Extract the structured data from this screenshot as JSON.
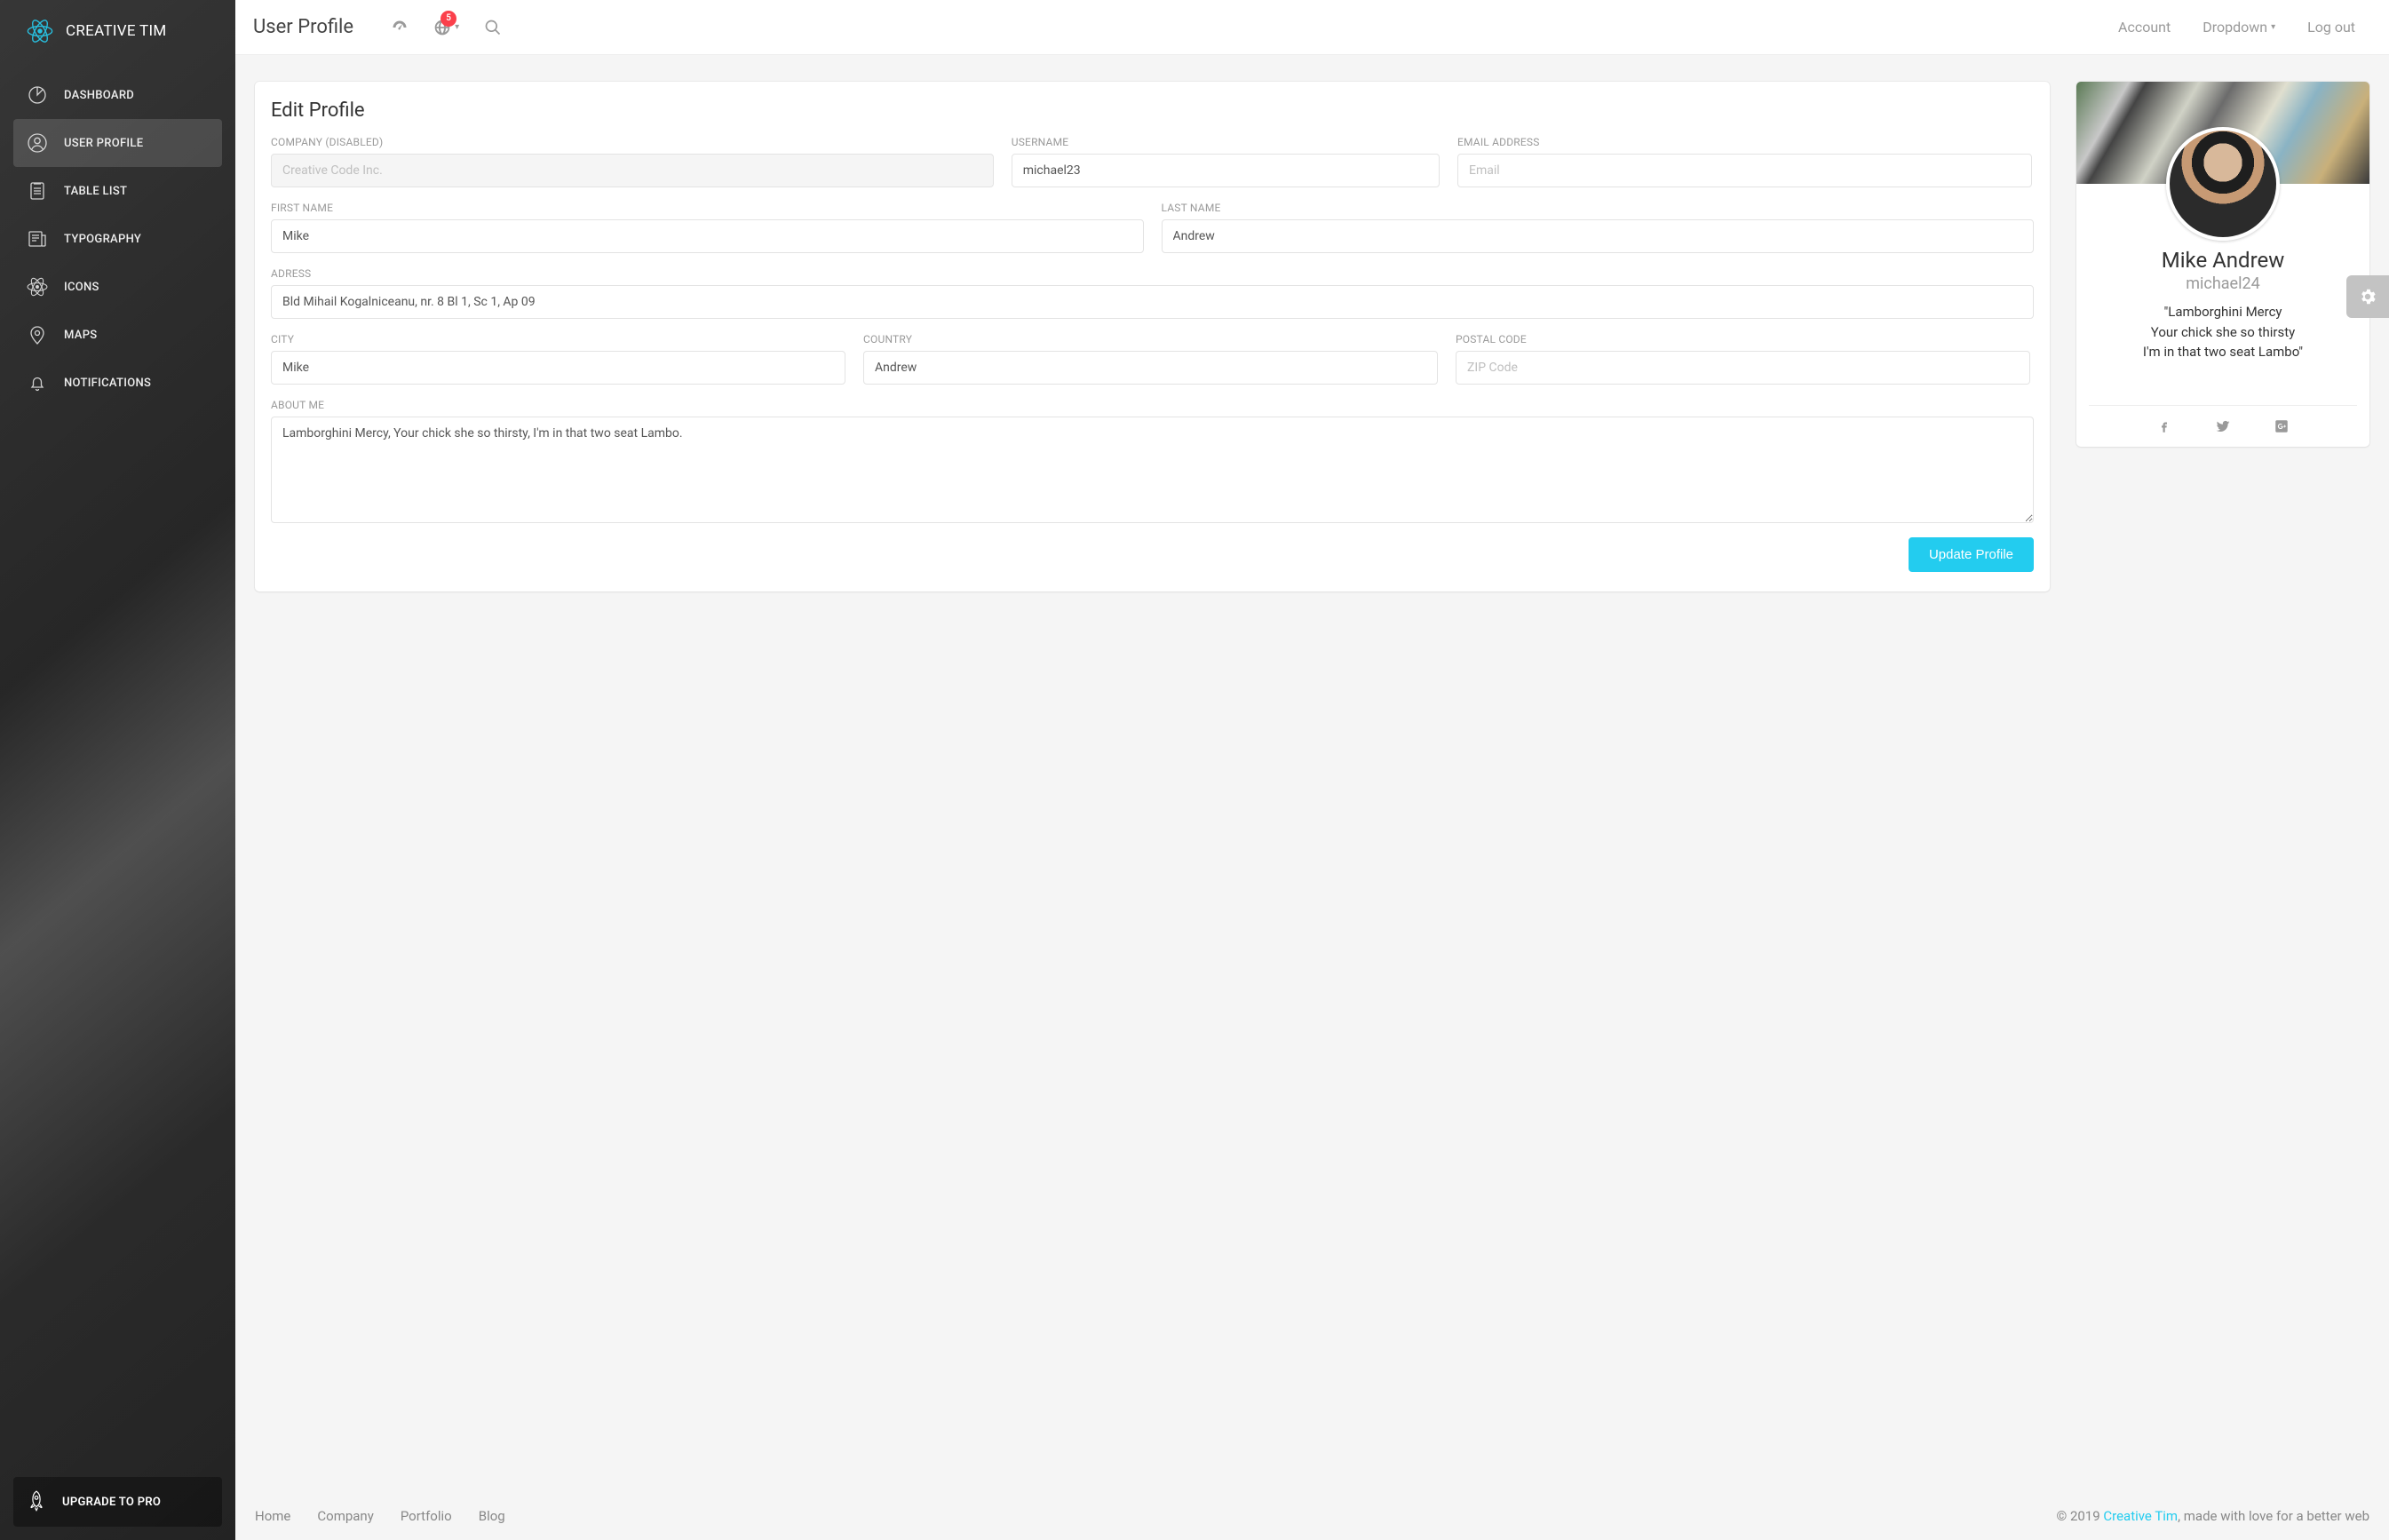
{
  "brand": "CREATIVE TIM",
  "sidebar": {
    "items": [
      {
        "label": "DASHBOARD"
      },
      {
        "label": "USER PROFILE",
        "active": true
      },
      {
        "label": "TABLE LIST"
      },
      {
        "label": "TYPOGRAPHY"
      },
      {
        "label": "ICONS"
      },
      {
        "label": "MAPS"
      },
      {
        "label": "NOTIFICATIONS"
      }
    ],
    "upgrade_label": "UPGRADE TO PRO"
  },
  "topbar": {
    "title": "User Profile",
    "notification_count": "5",
    "links": {
      "account": "Account",
      "dropdown": "Dropdown",
      "logout": "Log out"
    }
  },
  "form": {
    "heading": "Edit Profile",
    "labels": {
      "company": "COMPANY (DISABLED)",
      "username": "USERNAME",
      "email": "EMAIL ADDRESS",
      "first_name": "FIRST NAME",
      "last_name": "LAST NAME",
      "address": "ADRESS",
      "city": "CITY",
      "country": "COUNTRY",
      "postal": "POSTAL CODE",
      "about": "ABOUT ME"
    },
    "placeholders": {
      "company": "Creative Code Inc.",
      "email": "Email",
      "postal": "ZIP Code"
    },
    "values": {
      "username": "michael23",
      "first_name": "Mike",
      "last_name": "Andrew",
      "address": "Bld Mihail Kogalniceanu, nr. 8 Bl 1, Sc 1, Ap 09",
      "city": "Mike",
      "country": "Andrew",
      "about": "Lamborghini Mercy, Your chick she so thirsty, I'm in that two seat Lambo."
    },
    "submit_label": "Update Profile"
  },
  "profile": {
    "name": "Mike Andrew",
    "handle": "michael24",
    "quote": "\"Lamborghini Mercy\nYour chick she so thirsty\nI'm in that two seat Lambo\""
  },
  "footer": {
    "links": [
      "Home",
      "Company",
      "Portfolio",
      "Blog"
    ],
    "copyright_prefix": "© 2019 ",
    "brand_link": "Creative Tim",
    "copyright_suffix": ", made with love for a better web"
  }
}
